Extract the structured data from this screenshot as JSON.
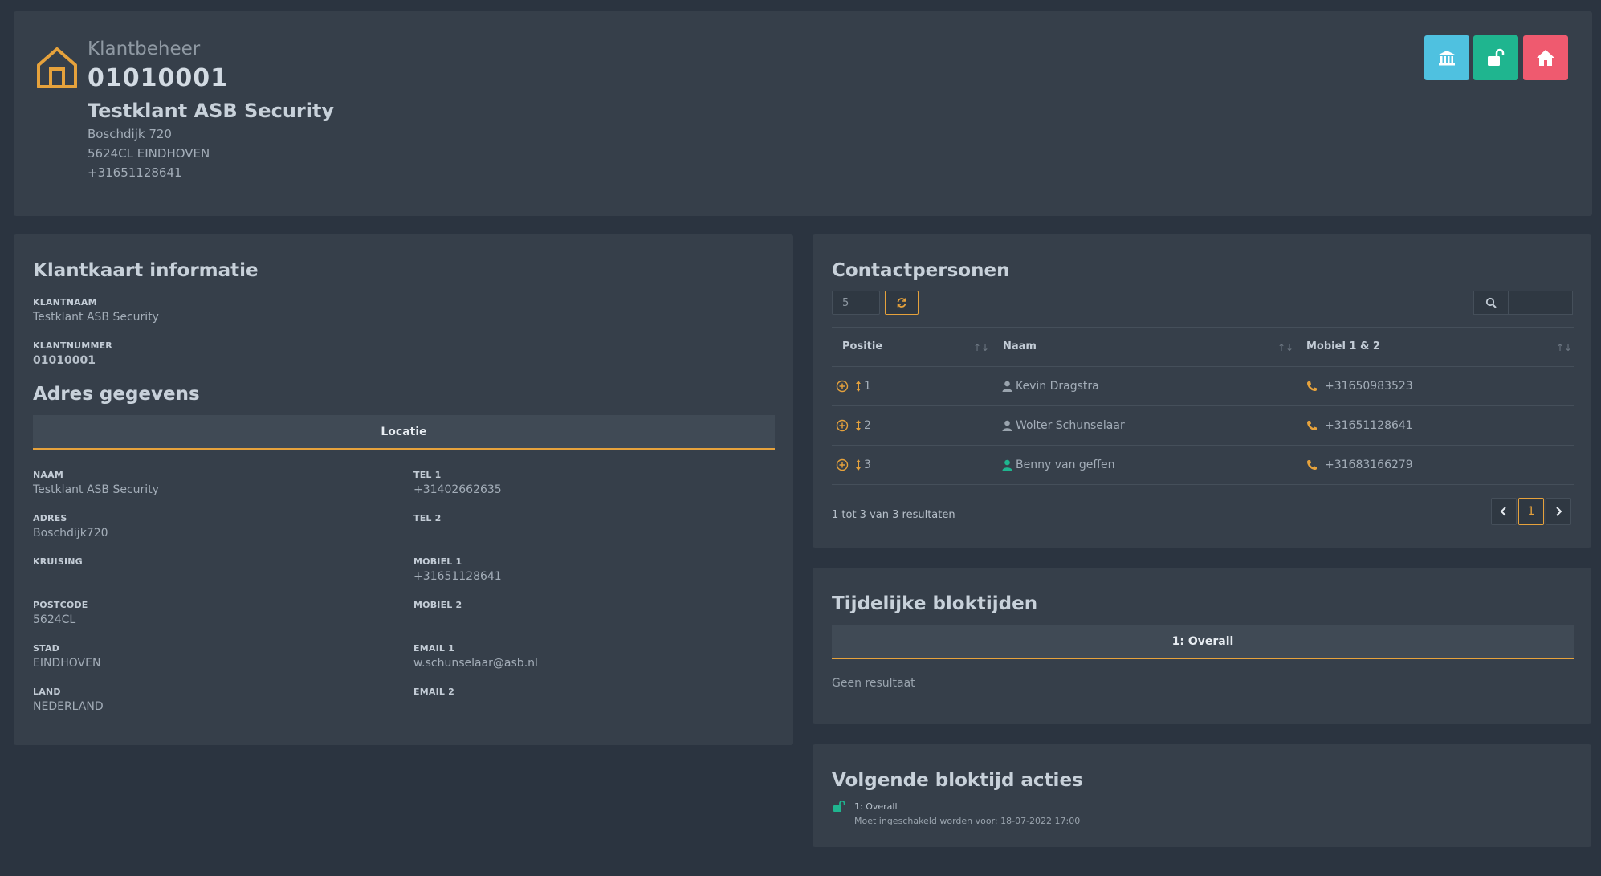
{
  "header": {
    "subtitle": "Klantbeheer",
    "number": "01010001",
    "name": "Testklant ASB Security",
    "address": "Boschdijk 720",
    "city": "5624CL EINDHOVEN",
    "phone": "+31651128641",
    "buttons": [
      {
        "icon": "bank-icon",
        "color": "#4fc1e0"
      },
      {
        "icon": "unlock-icon",
        "color": "#1fb58f"
      },
      {
        "icon": "home-icon",
        "color": "#ef5a6f"
      }
    ]
  },
  "klantkaart": {
    "title": "Klantkaart informatie",
    "klantnaam_label": "KLANTNAAM",
    "klantnaam": "Testklant ASB Security",
    "klantnummer_label": "KLANTNUMMER",
    "klantnummer": "01010001",
    "adres_title": "Adres gegevens",
    "tab": "Locatie",
    "left_fields": [
      {
        "label": "NAAM",
        "value": "Testklant ASB Security"
      },
      {
        "label": "ADRES",
        "value": "Boschdijk720"
      },
      {
        "label": "KRUISING",
        "value": ""
      },
      {
        "label": "POSTCODE",
        "value": "5624CL"
      },
      {
        "label": "STAD",
        "value": "EINDHOVEN"
      },
      {
        "label": "LAND",
        "value": "NEDERLAND"
      }
    ],
    "right_fields": [
      {
        "label": "TEL 1",
        "value": "+31402662635"
      },
      {
        "label": "TEL 2",
        "value": ""
      },
      {
        "label": "MOBIEL 1",
        "value": "+31651128641"
      },
      {
        "label": "MOBIEL 2",
        "value": ""
      },
      {
        "label": "EMAIL 1",
        "value": "w.schunselaar@asb.nl"
      },
      {
        "label": "EMAIL 2",
        "value": ""
      }
    ]
  },
  "contacts": {
    "title": "Contactpersonen",
    "page_size": "5",
    "search_placeholder": "",
    "columns": [
      "Positie",
      "Naam",
      "Mobiel 1 & 2"
    ],
    "rows": [
      {
        "pos": "1",
        "name": "Kevin Dragstra",
        "mobile": "+31650983523",
        "person_color": "#9aa4ae"
      },
      {
        "pos": "2",
        "name": "Wolter Schunselaar",
        "mobile": "+31651128641",
        "person_color": "#9aa4ae"
      },
      {
        "pos": "3",
        "name": "Benny van geffen",
        "mobile": "+31683166279",
        "person_color": "#1fb58f"
      }
    ],
    "summary": "1 tot 3 van 3 resultaten",
    "current_page": "1"
  },
  "tijdelijke": {
    "title": "Tijdelijke bloktijden",
    "tab": "1: Overall",
    "empty": "Geen resultaat"
  },
  "volgende": {
    "title": "Volgende bloktijd acties",
    "item_title": "1: Overall",
    "item_detail": "Moet ingeschakeld worden voor: 18-07-2022 17:00"
  },
  "colors": {
    "accent": "#e6a23c",
    "panel": "#363f4a",
    "background": "#2b3440"
  }
}
